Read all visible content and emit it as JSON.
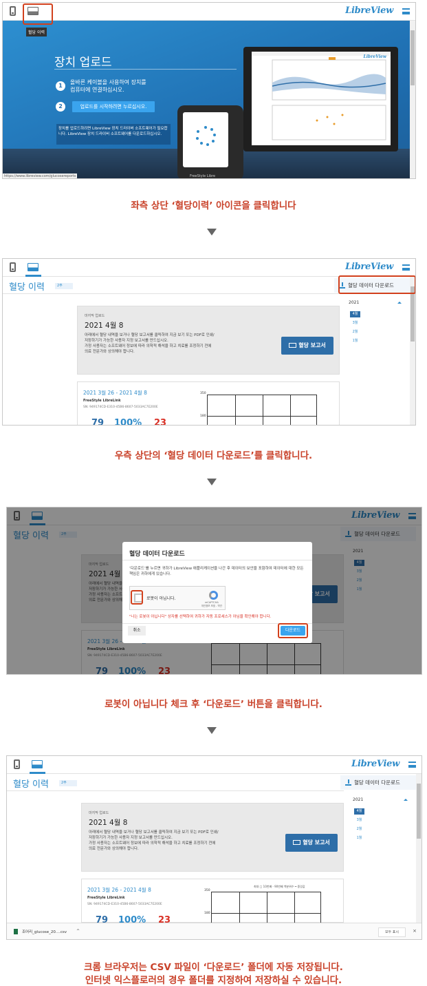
{
  "app": {
    "brand": "LibreView"
  },
  "tooltip": "혈당 이력",
  "upload": {
    "title": "장치 업로드",
    "step1_num": "1",
    "step1_text": "올바른 케이블을 사용하여 장치를\n컴퓨터에 연결하십시오.",
    "step2_num": "2",
    "step2_button": "업로드를 시작하려면 누르십시오.",
    "note": "장치를 업로드하려면 LibreView 장치 드라이버 소프트웨어가 필요합니다. LibreView 장치 드라이버 소프트웨어를 다운로드하십시오.",
    "device_label": "FreeStyle Libre",
    "url": "https://www.libreview.com/glucosereports"
  },
  "captions": {
    "step1": "좌측 상단 ‘혈당이력’ 아이콘을 클릭합니다",
    "step2": "우측 상단의 ‘혈당 데이터 다운로드’를 클릭합니다.",
    "step3": "로봇이 아닙니다 체크 후 ‘다운로드’ 버튼을 클릭합니다.",
    "step4_line1": "크롬 브라우저는 CSV 파일이 ‘다운로드’ 폴더에 자동 저장됩니다.",
    "step4_line2": "인터넷 익스플로러의 경우 폴더를 지정하여 저장하실 수 있습니다."
  },
  "history": {
    "title": "혈당 이력",
    "period_select": "2주",
    "download_button": "혈당 데이터 다운로드",
    "sidebar": {
      "year": "2021",
      "months": [
        "4월",
        "3월",
        "2월",
        "1월"
      ]
    },
    "last_upload_label": "마지막 업로드",
    "last_upload_date": "2021 4월 8",
    "body": "아래에서 혈당 내역을 보거나 혈당 보고서를 클릭하여 지금 보기 또는 PDF로 인쇄/저장하기가 가능한 사용자 지정 보고서를 만드십시오.\n가정 사용자는 소프트웨어 정보에 따라 의학적 해석을 하고 치료를 조정하기 전에 의료 전문가와 상의해야 합니다.",
    "report_button": "혈당 보고서",
    "range": "2021 3월 26 - 2021 4월 8",
    "product": "FreeStyle LibreLink",
    "serial": "SN: 949174CD-E310-45B6-8607-5033AC7E200E",
    "stat1": "79",
    "stat2": "100%",
    "stat3": "23",
    "y_top": "350",
    "y_unit": "mg/dL",
    "y_mid": "180",
    "legend": "최대  □ 10번째 - 90번째 백분위수  ━ 중앙값"
  },
  "modal": {
    "title": "혈당 데이터 다운로드",
    "body": "‘다운로드’를 누르면 귀하가 LibreView 애플리케이션을 나간 후 데이터의 보안을 포함하여 데이터에 대한 모든 책임은 귀하에게 있습니다.",
    "captcha_label": "로봇이 아닙니다.",
    "captcha_brand": "reCAPTCHA",
    "captcha_terms": "개인정보 보호 - 약관",
    "warning": "\"나는 로봇이 아닙니다\" 상자를 선택하여 귀하가 자동 프로세스가 아님을 확인해야 합니다.",
    "cancel": "취소",
    "download": "다운로드"
  },
  "shelf": {
    "file": "조어리_glucose_20....csv",
    "caret": "^",
    "show_all": "모두 표시",
    "close": "×"
  },
  "colors": {
    "accent": "#2e8bc9",
    "highlight": "#d2401c",
    "caption": "#c9422a"
  }
}
